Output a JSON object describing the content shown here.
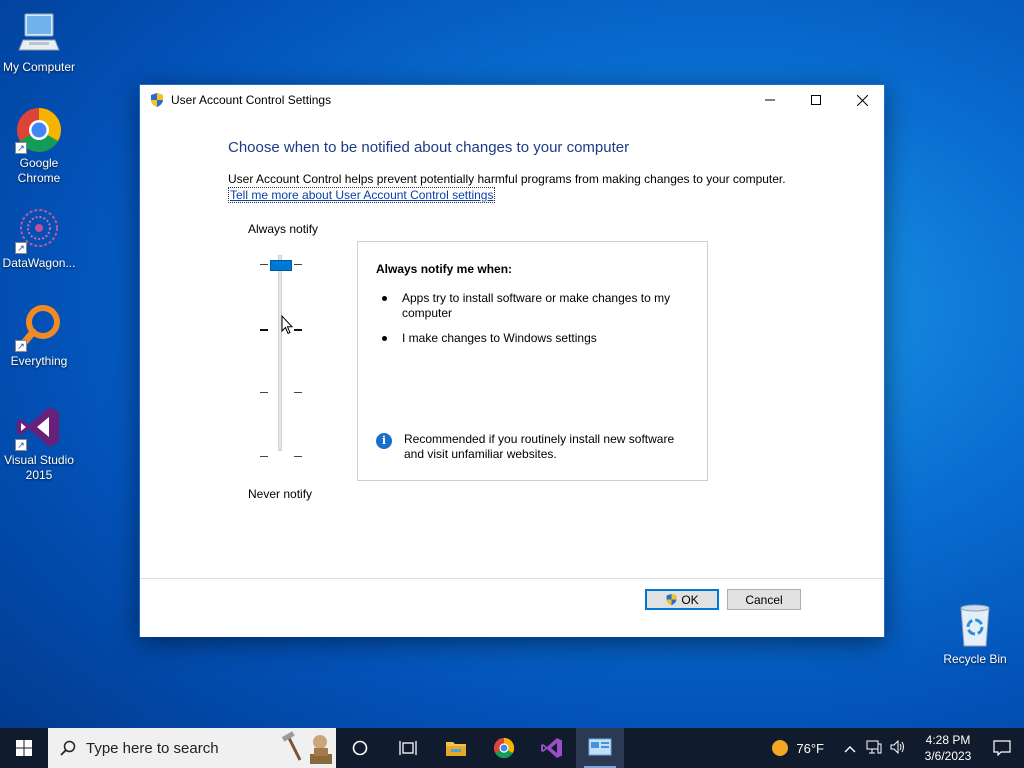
{
  "desktop": {
    "icons": [
      {
        "label": "My Computer",
        "icon": "computer-icon"
      },
      {
        "label": "Google Chrome",
        "icon": "chrome-icon"
      },
      {
        "label": "DataWagon...",
        "icon": "datawagon-icon"
      },
      {
        "label": "Everything",
        "icon": "everything-icon"
      },
      {
        "label": "Visual Studio 2015",
        "icon": "visual-studio-icon"
      },
      {
        "label": "Recycle Bin",
        "icon": "recycle-bin-icon"
      }
    ]
  },
  "dialog": {
    "title": "User Account Control Settings",
    "heading": "Choose when to be notified about changes to your computer",
    "description": "User Account Control helps prevent potentially harmful programs from making changes to your computer.",
    "link": "Tell me more about User Account Control settings",
    "slider": {
      "top_label": "Always notify",
      "bottom_label": "Never notify",
      "levels": 4,
      "selected_level": 1
    },
    "info": {
      "title": "Always notify me when:",
      "bullets": [
        "Apps try to install software or make changes to my computer",
        "I make changes to Windows settings"
      ],
      "recommendation": "Recommended if you routinely install new software and visit unfamiliar websites."
    },
    "buttons": {
      "ok": "OK",
      "cancel": "Cancel"
    }
  },
  "taskbar": {
    "search_placeholder": "Type here to search",
    "weather": "76°F",
    "time": "4:28 PM",
    "date": "3/6/2023"
  },
  "colors": {
    "accent": "#0078d7",
    "heading": "#1d3a8a",
    "taskbar": "#101b2d"
  }
}
